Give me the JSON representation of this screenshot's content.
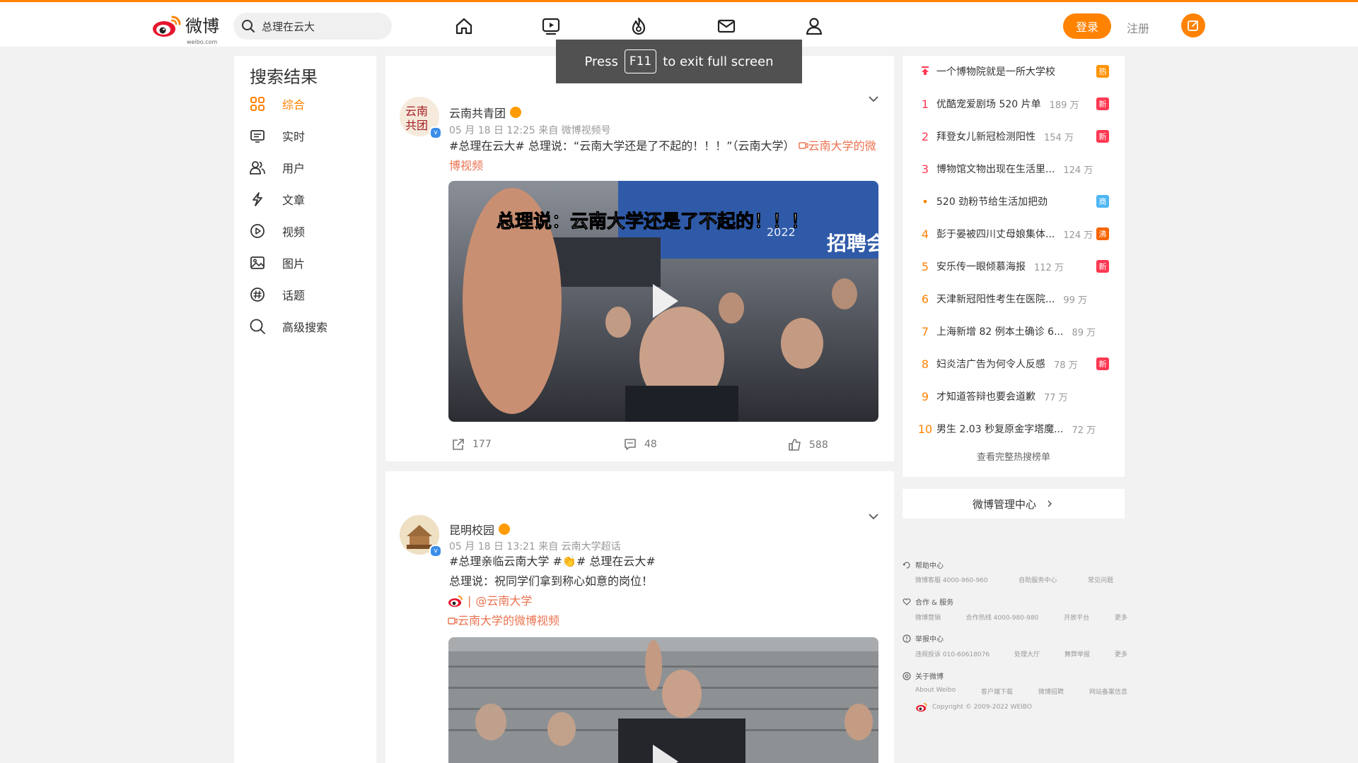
{
  "header": {
    "logo_text": "微博",
    "logo_sub": "weibo.com",
    "search_value": "总理在云大",
    "login_label": "登录",
    "register_label": "注册",
    "nav_icons": [
      "home-icon",
      "video-icon",
      "hot-icon",
      "message-icon",
      "profile-icon"
    ]
  },
  "fullscreen_toast": {
    "press": "Press",
    "key": "F11",
    "rest": "to exit full screen"
  },
  "sidebar": {
    "title": "搜索结果",
    "items": [
      {
        "label": "综合",
        "icon": "grid-icon",
        "active": true
      },
      {
        "label": "实时",
        "icon": "realtime-icon"
      },
      {
        "label": "用户",
        "icon": "users-icon"
      },
      {
        "label": "文章",
        "icon": "article-icon"
      },
      {
        "label": "视频",
        "icon": "play-circle-icon"
      },
      {
        "label": "图片",
        "icon": "image-icon"
      },
      {
        "label": "话题",
        "icon": "topic-icon"
      },
      {
        "label": "高级搜索",
        "icon": "search-icon"
      }
    ]
  },
  "posts": [
    {
      "user": "云南共青团",
      "meta": "05 月 18 日 12:25  来自 微博视频号",
      "text": "#总理在云大# 总理说：“云南大学还是了不起的！！！”（云南大学）",
      "link": "云南大学的微博视频",
      "video_caption": "总理说：云南大学还是了不起的！！！",
      "video_banner": "招聘会",
      "video_year": "2022",
      "reposts": "177",
      "comments": "48",
      "likes": "588"
    },
    {
      "user": "昆明校园",
      "meta": "05 月 18 日 13:21  来自 云南大学超话",
      "text_line1": "#总理亲临云南大学 #👏# 总理在云大#",
      "text_line2": "总理说：祝同学们拿到称心如意的岗位！",
      "mention": "@云南大学",
      "link": "云南大学的微博视频"
    }
  ],
  "hot_search": {
    "pinned": {
      "title": "一个博物院就是一所大学校",
      "badge": "热"
    },
    "items": [
      {
        "rank": "1",
        "title": "优酷宠爱剧场 520 片单",
        "count": "189 万",
        "badge": "新",
        "badge_color": "#ff3852"
      },
      {
        "rank": "2",
        "title": "拜登女儿新冠检测阳性",
        "count": "154 万",
        "badge": "新",
        "badge_color": "#ff3852"
      },
      {
        "rank": "3",
        "title": "博物馆文物出现在生活里...",
        "count": "124 万",
        "badge": "",
        "badge_color": ""
      },
      {
        "rank": "•",
        "title": "520 劲粉节给生活加把劲",
        "count": "",
        "badge": "商",
        "badge_color": "#4fb6f3"
      },
      {
        "rank": "4",
        "title": "彭于晏被四川丈母娘集体...",
        "count": "124 万",
        "badge": "沸",
        "badge_color": "#f86400"
      },
      {
        "rank": "5",
        "title": "安乐传一眼倾慕海报",
        "count": "112 万",
        "badge": "新",
        "badge_color": "#ff3852"
      },
      {
        "rank": "6",
        "title": "天津新冠阳性考生在医院...",
        "count": "99 万",
        "badge": "",
        "badge_color": ""
      },
      {
        "rank": "7",
        "title": "上海新增 82 例本土确诊 6...",
        "count": "89 万",
        "badge": "",
        "badge_color": ""
      },
      {
        "rank": "8",
        "title": "妇炎洁广告为何令人反感",
        "count": "78 万",
        "badge": "新",
        "badge_color": "#ff3852"
      },
      {
        "rank": "9",
        "title": "才知道答辩也要会道歉",
        "count": "77 万",
        "badge": "",
        "badge_color": ""
      },
      {
        "rank": "10",
        "title": "男生 2.03 秒复原金字塔魔...",
        "count": "72 万",
        "badge": "",
        "badge_color": ""
      }
    ],
    "more": "查看完整热搜榜单"
  },
  "manage_center": "微博管理中心",
  "footer": {
    "sections": [
      {
        "title": "帮助中心",
        "links": [
          "微博客服 4000-960-960",
          "自助服务中心",
          "常见问题"
        ]
      },
      {
        "title": "合作 & 服务",
        "links": [
          "微博营销",
          "合作热线 4000-980-980",
          "开放平台",
          "更多"
        ]
      },
      {
        "title": "举报中心",
        "links": [
          "违规投诉 010-60618076",
          "处理大厅",
          "舞弊举报",
          "更多"
        ]
      },
      {
        "title": "关于微博",
        "links": [
          "About Weibo",
          "客户端下载",
          "微博招聘",
          "网站备案信息"
        ]
      }
    ],
    "copyright": "Copyright © 2009-2022 WEIBO"
  },
  "colors": {
    "accent": "#ff8200",
    "hot_red": "#ff3852",
    "link": "#eb7350"
  }
}
